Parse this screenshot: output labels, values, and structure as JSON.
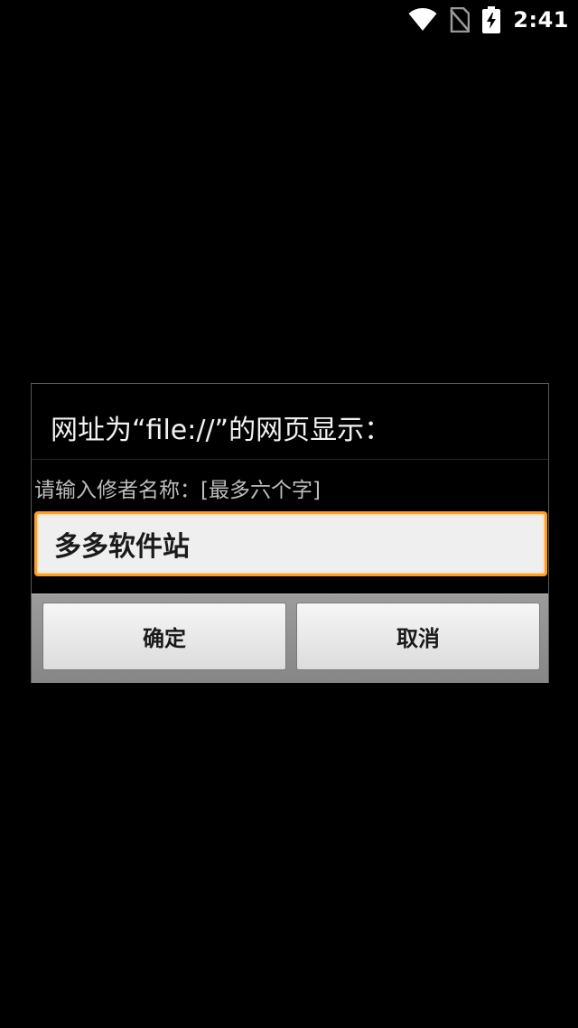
{
  "status_bar": {
    "time": "2:41",
    "icons": [
      "wifi-icon",
      "no-sim-icon",
      "battery-charging-icon"
    ]
  },
  "dialog": {
    "title": "网址为“file://”的网页显示：",
    "message": "请输入修者名称：[最多六个字]",
    "input_value": "多多软件站",
    "ok_label": "确定",
    "cancel_label": "取消"
  },
  "colors": {
    "background": "#000000",
    "input_focus_border": "#ff9d1f",
    "button_bar": "#8f8f8f"
  }
}
